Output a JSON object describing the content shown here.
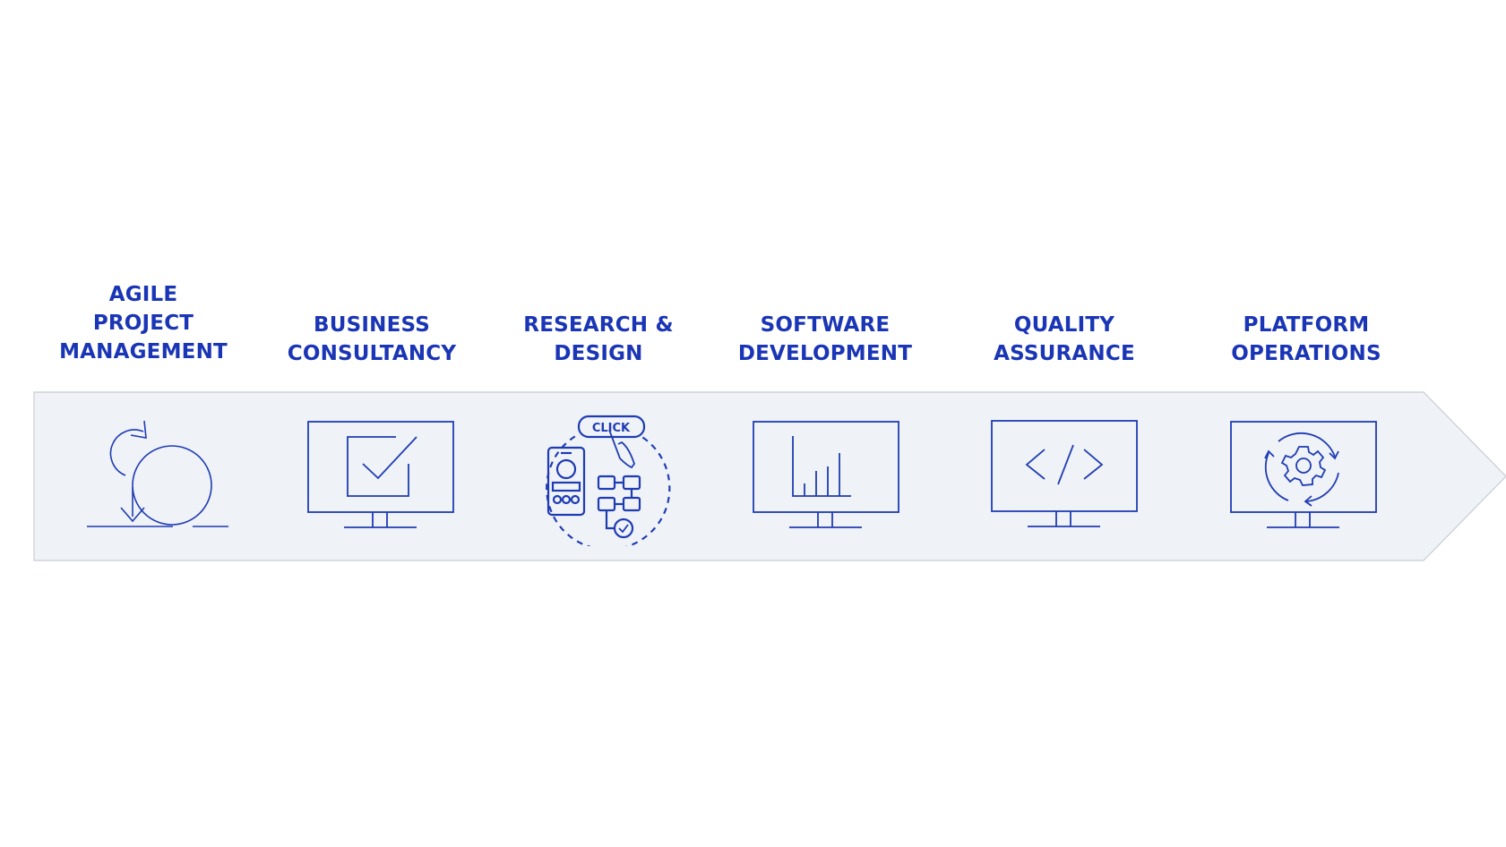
{
  "diagram": {
    "type": "process-arrow",
    "colors": {
      "text": "#1a35b5",
      "icon_stroke": "#1f3bb3",
      "band_fill": "#eff3f7",
      "band_border": "#c8ccd2"
    },
    "stages": [
      {
        "label_lines": [
          "AGILE",
          "PROJECT",
          "MANAGEMENT"
        ],
        "icon": "agile-loop-icon"
      },
      {
        "label_lines": [
          "BUSINESS",
          "CONSULTANCY"
        ],
        "icon": "monitor-checkbox-icon"
      },
      {
        "label_lines": [
          "RESEARCH &",
          "DESIGN"
        ],
        "icon": "ux-click-flow-icon",
        "icon_text": "CLICK"
      },
      {
        "label_lines": [
          "SOFTWARE",
          "DEVELOPMENT"
        ],
        "icon": "monitor-bar-chart-icon"
      },
      {
        "label_lines": [
          "QUALITY",
          "ASSURANCE"
        ],
        "icon": "monitor-code-icon"
      },
      {
        "label_lines": [
          "PLATFORM",
          "OPERATIONS"
        ],
        "icon": "monitor-gear-cycle-icon"
      }
    ]
  }
}
